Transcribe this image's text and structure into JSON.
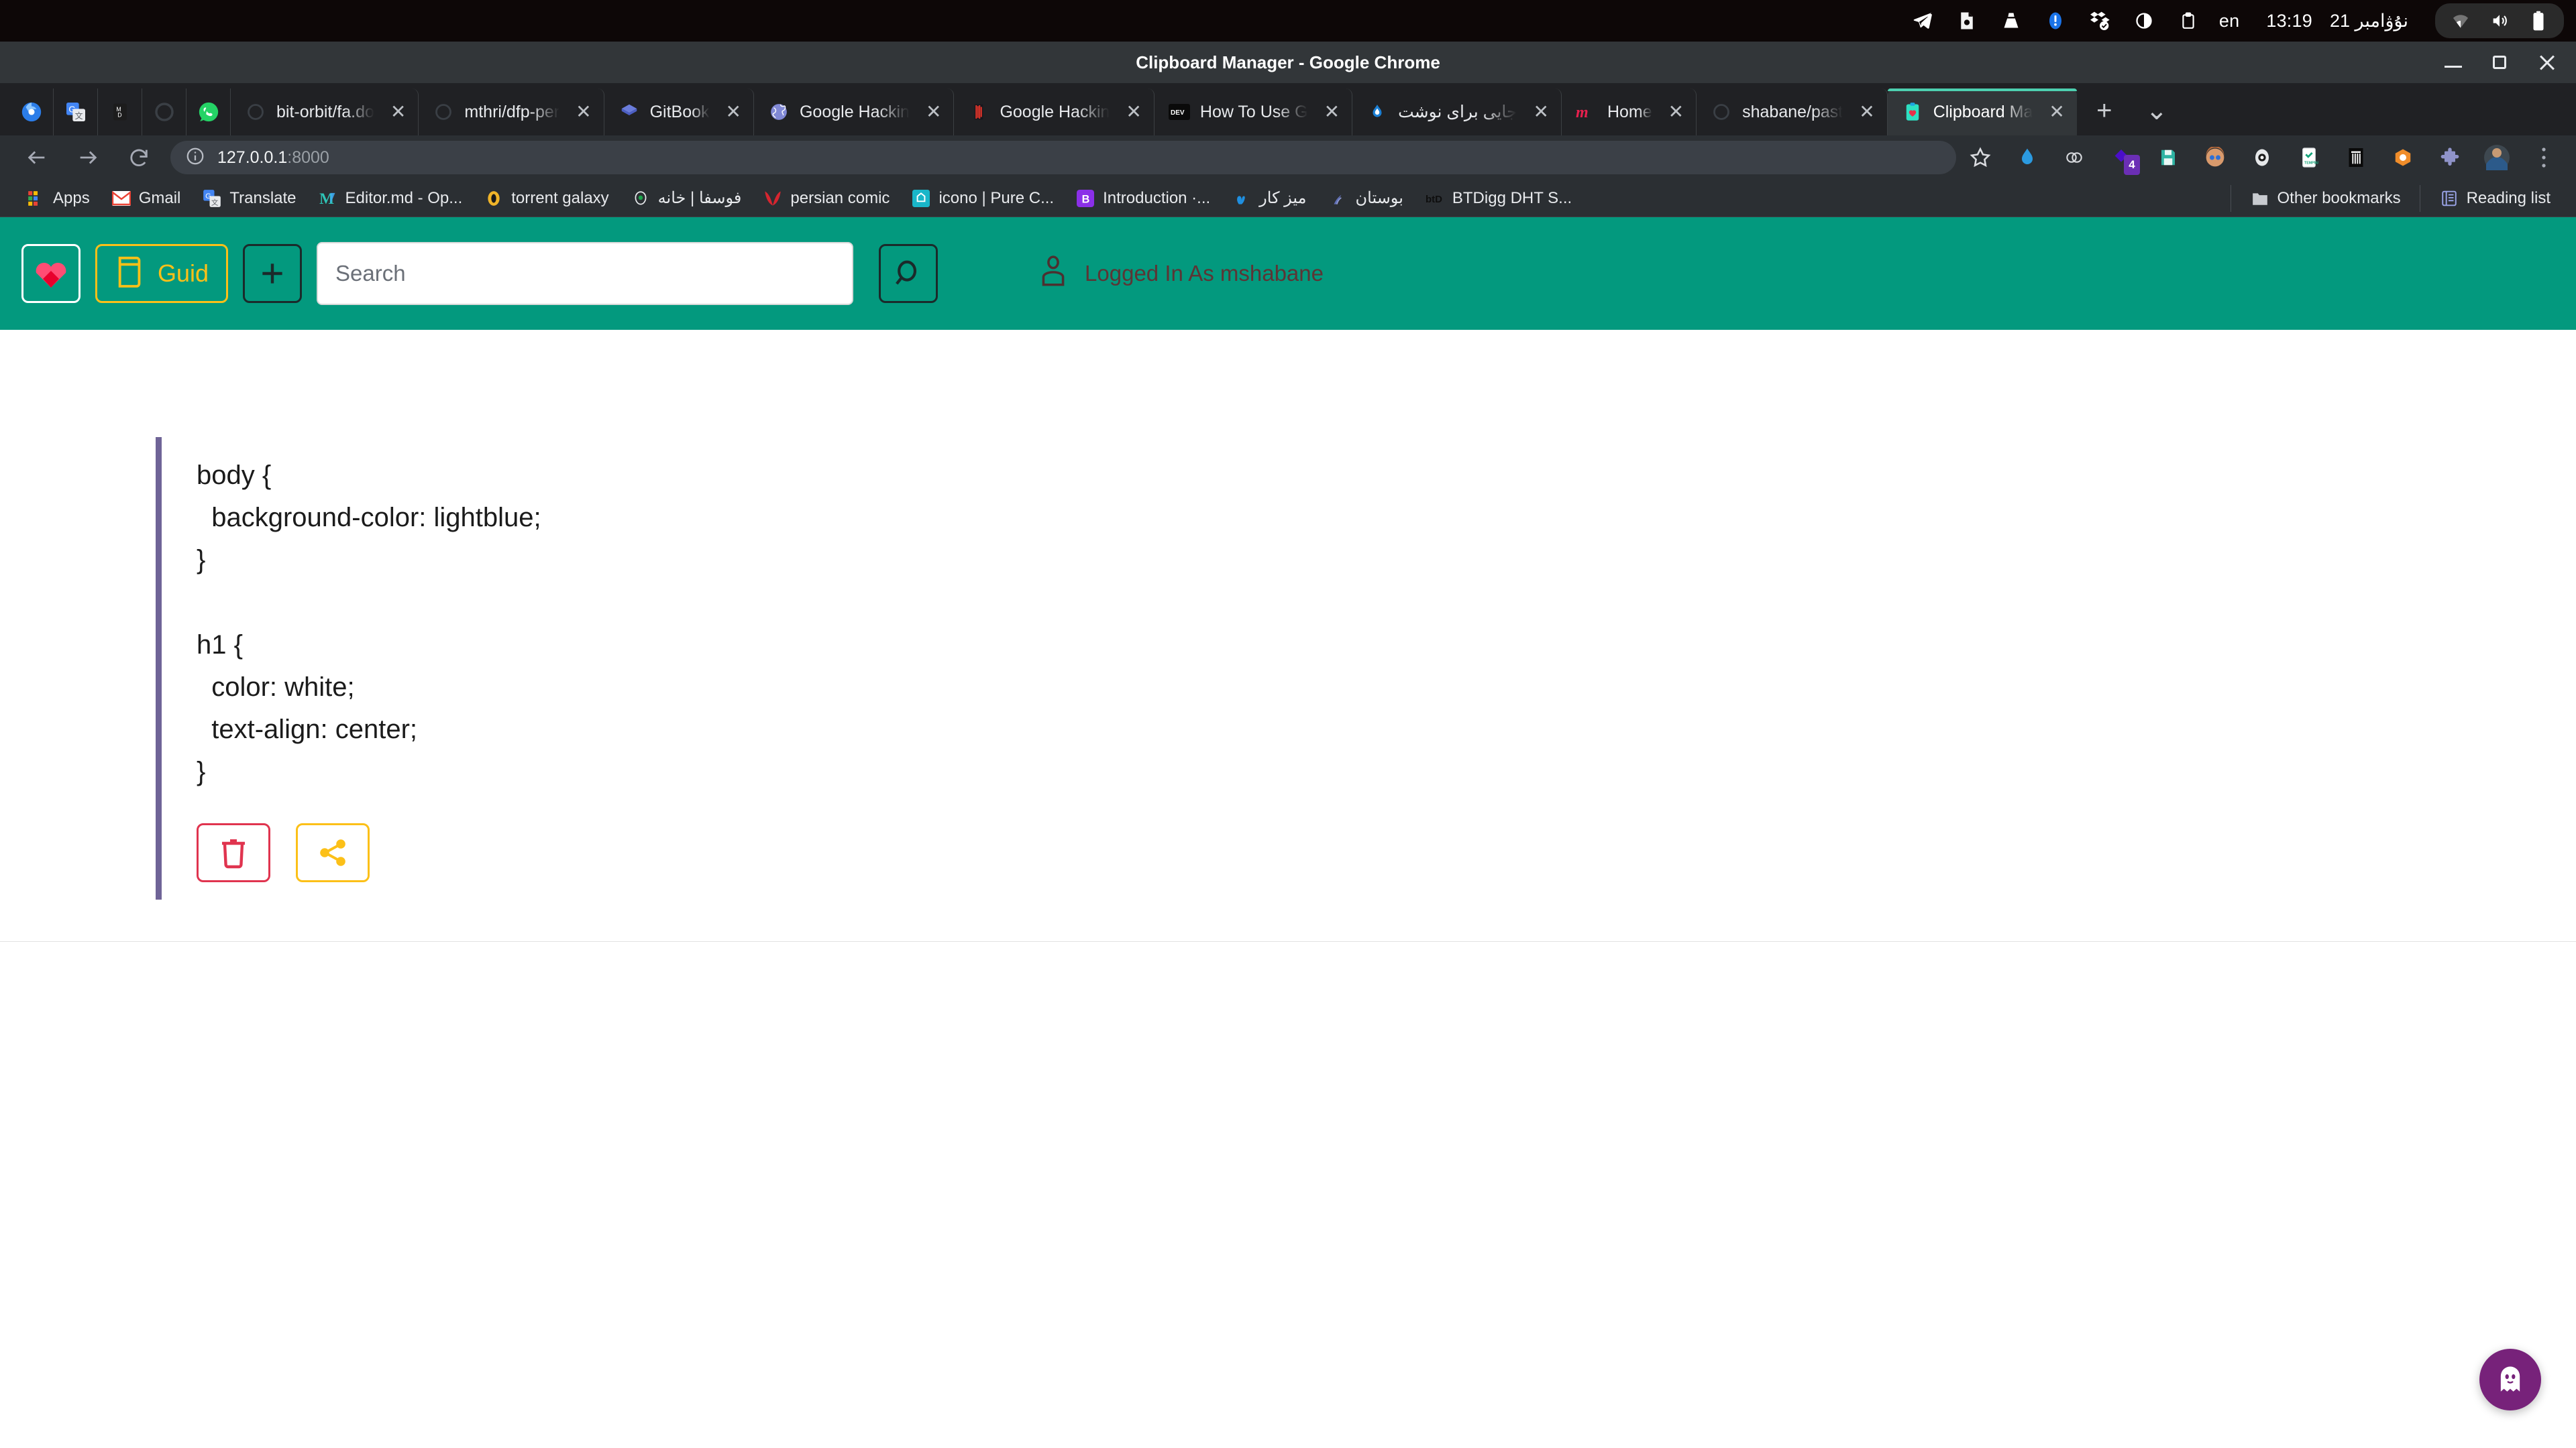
{
  "os": {
    "tray_icons": [
      "telegram-icon",
      "screenshot-icon",
      "vlc-icon",
      "notification-icon",
      "dropbox-icon",
      "brightness-icon",
      "clipboard-icon"
    ],
    "keyboard_layout": "en",
    "date": "نۇۋامبر 21",
    "time": "13:19",
    "status_icons": [
      "wifi-icon",
      "volume-icon",
      "battery-icon"
    ]
  },
  "window": {
    "title": "Clipboard Manager - Google Chrome",
    "controls": [
      "minimize",
      "maximize",
      "close"
    ]
  },
  "browser": {
    "pinned_tabs": [
      "chrome-icon",
      "translate-icon",
      "markdown-icon",
      "firefox-icon",
      "whatsapp-icon"
    ],
    "tabs": [
      {
        "label": "bit-orbit/fa.do",
        "icon": "globe-icon",
        "active": false
      },
      {
        "label": "mthri/dfp-per",
        "icon": "globe-icon",
        "active": false
      },
      {
        "label": "GitBook",
        "icon": "gitbook-icon",
        "active": false
      },
      {
        "label": "Google Hackin",
        "icon": "globe-purple-icon",
        "active": false
      },
      {
        "label": "Google Hackin",
        "icon": "red-door-icon",
        "active": false
      },
      {
        "label": "How To Use G",
        "icon": "dev-icon",
        "active": false
      },
      {
        "label": "جایی برای نوشت",
        "icon": "virgool-icon",
        "active": false
      },
      {
        "label": "Home",
        "icon": "medium-icon",
        "active": false
      },
      {
        "label": "shabane/past",
        "icon": "globe-icon",
        "active": false
      },
      {
        "label": "Clipboard Ma",
        "icon": "clipboard-heart-icon",
        "active": true
      }
    ],
    "new_tab_label": "+",
    "tab_search_label": "⌄",
    "nav": {
      "back": "←",
      "forward": "→",
      "reload": "⟳"
    },
    "omnibox": {
      "host": "127.0.0.1",
      "port": ":8000",
      "site_info": "info-icon"
    },
    "toolbar_icons": [
      "bookmark-star-icon",
      "chrome-drop-icon",
      "rings-icon",
      "affinity-icon",
      "save-icon",
      "avatar-girl-icon",
      "eye-icon",
      "tempmail-icon",
      "trashcan-icon",
      "honey-icon",
      "puzzle-icon",
      "profile-avatar-icon",
      "three-dots-menu-icon"
    ],
    "extension_badge_count": "4",
    "bookmarks": [
      {
        "label": "Apps",
        "icon": "apps-grid-icon"
      },
      {
        "label": "Gmail",
        "icon": "gmail-icon"
      },
      {
        "label": "Translate",
        "icon": "translate-icon"
      },
      {
        "label": "Editor.md - Op...",
        "icon": "markdown-m-icon"
      },
      {
        "label": "torrent galaxy",
        "icon": "torrentgalaxy-icon"
      },
      {
        "label": "فوسفا | خانه",
        "icon": "jossfa-icon"
      },
      {
        "label": "persian comic",
        "icon": "comic-icon"
      },
      {
        "label": "icono | Pure C...",
        "icon": "icono-icon"
      },
      {
        "label": "Introduction ·...",
        "icon": "bitwarden-b-icon"
      },
      {
        "label": "میز کار",
        "icon": "blue-hand-icon"
      },
      {
        "label": "بوستان",
        "icon": "boostan-icon"
      },
      {
        "label": "BTDigg DHT S...",
        "icon": "btdigg-icon"
      }
    ],
    "other_bookmarks_label": "Other bookmarks",
    "reading_list_label": "Reading list"
  },
  "app": {
    "header": {
      "logo_title": "heart-logo-button",
      "guid_label": "Guid",
      "add_label": "+",
      "accent_teal": "#03997e",
      "accent_amber": "#fcc018"
    },
    "search": {
      "placeholder": "Search",
      "value": ""
    },
    "user": {
      "status_text": "Logged In As mshabane",
      "icon": "user-icon"
    },
    "clip": {
      "lines": [
        "body {",
        "  background-color: lightblue;",
        "}",
        "",
        "h1 {",
        "  color: white;",
        "  text-align: center;",
        "}"
      ],
      "delete_icon": "trash-icon",
      "share_icon": "share-icon",
      "accent_bar_color": "#6f6497",
      "delete_color": "#e0344f",
      "share_color": "#fcc018"
    },
    "fab": {
      "icon": "ghost-icon",
      "color": "#77227a"
    }
  }
}
